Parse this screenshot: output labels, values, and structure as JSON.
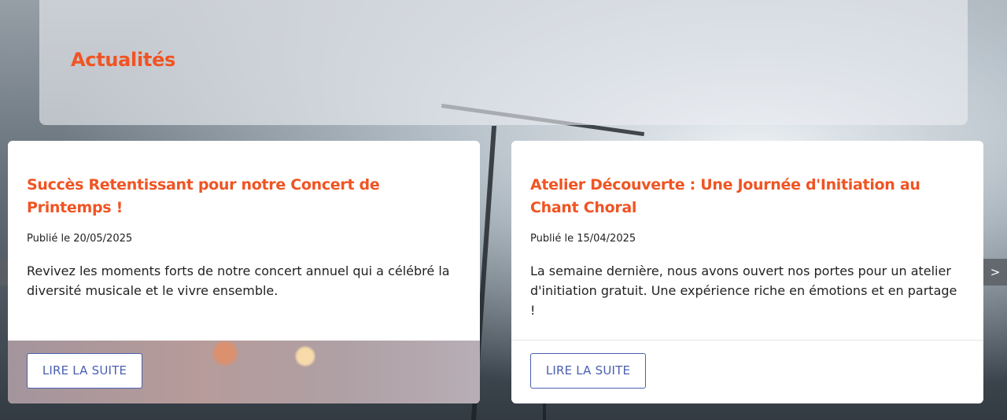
{
  "section": {
    "title": "Actualités"
  },
  "articles": [
    {
      "title": "Succès Retentissant pour notre Concert de Printemps !",
      "date": "Publié le 20/05/2025",
      "excerpt": "Revivez les moments forts de notre concert annuel qui a célébré la diversité musicale et le vivre ensemble.",
      "button_label": "LIRE LA SUITE"
    },
    {
      "title": "Atelier Découverte : Une Journée d'Initiation au Chant Choral",
      "date": "Publié le 15/04/2025",
      "excerpt": "La semaine dernière, nous avons ouvert nos portes pour un atelier d'initiation gratuit. Une expérience riche en émotions et en partage !",
      "button_label": "LIRE LA SUITE"
    }
  ],
  "carousel": {
    "prev_label": "<",
    "next_label": ">"
  },
  "colors": {
    "accent": "#f05423",
    "button": "#4a5fb0"
  }
}
